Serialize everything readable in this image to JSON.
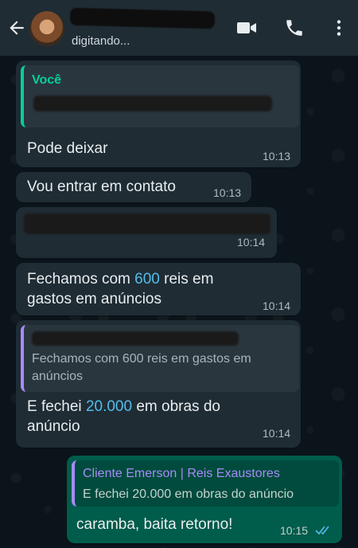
{
  "header": {
    "status": "digitando...",
    "icons": [
      "back-arrow-icon",
      "video-call-icon",
      "phone-icon",
      "more-options-icon"
    ]
  },
  "messages": [
    {
      "type": "incoming-with-quote",
      "quote_sender": "Você",
      "text": "Pode deixar",
      "time": "10:13"
    },
    {
      "type": "incoming",
      "text": "Vou entrar em contato",
      "time": "10:13"
    },
    {
      "type": "incoming",
      "text": "",
      "time": "10:14"
    },
    {
      "type": "incoming",
      "text_parts": [
        "Fechamos com ",
        "600",
        " reis em",
        "gastos em anúncios"
      ],
      "time": "10:14"
    },
    {
      "type": "incoming-with-quote",
      "quote_text": "Fechamos com 600 reis em gastos em anúncios",
      "text_parts": [
        "E fechei ",
        "20.000",
        " em obras do",
        "anúncio"
      ],
      "time": "10:14"
    },
    {
      "type": "outgoing-with-quote",
      "quote_sender": "Cliente Emerson | Reis Exaustores",
      "quote_text": "E fechei 20.000 em obras do anúncio",
      "text": "caramba, baita retorno!",
      "time": "10:15",
      "read": true
    }
  ],
  "colors": {
    "header": "#1f2c34",
    "incoming": "#1f2c34",
    "outgoing": "#005c4b",
    "link": "#53bdeb",
    "quote_you": "#06cf9c",
    "quote_other": "#a78bfa",
    "read_ticks": "#53bdeb"
  }
}
